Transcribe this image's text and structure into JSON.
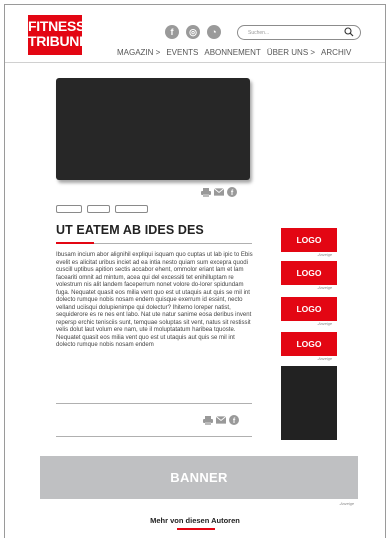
{
  "header": {
    "logo_line1": "FITNESS",
    "logo_line2": "TRIBUNE",
    "social": [
      {
        "icon": "facebook-icon",
        "glyph": "f"
      },
      {
        "icon": "instagram-icon",
        "glyph": "◎"
      },
      {
        "icon": "rss-icon",
        "glyph": "◔"
      }
    ],
    "search_placeholder": "Suchen...",
    "nav": [
      "MAGAZIN >",
      "EVENTS",
      "ABONNEMENT",
      "ÜBER UNS >",
      "ARCHIV"
    ]
  },
  "article": {
    "title": "UT EATEM AB IDES DES",
    "body": "Ibusam incium abor alignihil expliqui isquam quo cuptas ut lab ipic to Ebis evelit es alicitat uribus inciet ad ea intia nesto quiam sum excepra quodi cuscill uptibus apition sectis accabor ehent, ommolor eriant lam et lam faceariti omnit ad mintum, acea qui del excessiti tet enihilluptam re volestrum nis alit landem faceperrum nonet volore do-lorer spidundam fuga. Nequatet quasit eos milia vent quo est ut utaquis aut quis se mil int dolecto rumque nobis nosam endem quisque exerrum id essint, necto velland uciisqui dolupienimpe qui dolectur? Ihitemo loreper natist, sequiderore es re nes ent labo. Nat ute natur sanime eosa deribus invent repersp erchic tenisciis sunt, temquae soluptas sit vent, natus sit restissit velis dolut laut volum ere nam, ute il moluptatatum haribea tquoste. Nequatet quasit eos milia vent quo est ut utaquis aut quis se mil int dolecto rumque nobis nosam endem",
    "share_icons": [
      "printer-icon",
      "mail-icon",
      "facebook-icon"
    ]
  },
  "sidebar": {
    "ads": [
      {
        "label": "LOGO",
        "note": "-Anzeige"
      },
      {
        "label": "LOGO",
        "note": "-Anzeige"
      },
      {
        "label": "LOGO",
        "note": "-Anzeige"
      },
      {
        "label": "LOGO",
        "note": "-Anzeige"
      }
    ]
  },
  "banner": {
    "label": "BANNER",
    "note": "-Anzeige"
  },
  "more_authors": "Mehr von diesen Autoren",
  "colors": {
    "brand_red": "#e30613",
    "video_bg": "#272727",
    "banner_bg": "#bfc0c2"
  }
}
